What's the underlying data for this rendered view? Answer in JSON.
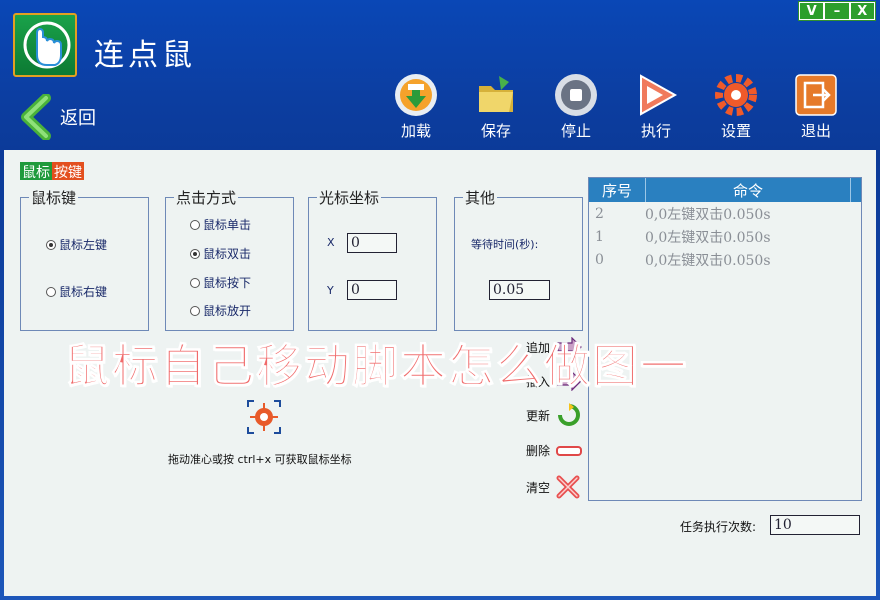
{
  "window": {
    "title": "连点鼠",
    "controls": [
      "V",
      "–",
      "X"
    ]
  },
  "nav": {
    "back_label": "返回"
  },
  "toolbar": [
    {
      "label": "加载",
      "icon": "load-icon"
    },
    {
      "label": "保存",
      "icon": "save-folder-icon"
    },
    {
      "label": "停止",
      "icon": "stop-icon"
    },
    {
      "label": "执行",
      "icon": "play-icon"
    },
    {
      "label": "设置",
      "icon": "gear-icon"
    },
    {
      "label": "退出",
      "icon": "exit-icon"
    }
  ],
  "tabs": {
    "mouse": "鼠标",
    "keyboard": "按键"
  },
  "mouse_key": {
    "title": "鼠标键",
    "left": "鼠标左键",
    "right": "鼠标右键"
  },
  "click_mode": {
    "title": "点击方式",
    "single": "鼠标单击",
    "double": "鼠标双击",
    "press": "鼠标按下",
    "release": "鼠标放开"
  },
  "cursor": {
    "title": "光标坐标",
    "x_label": "X",
    "y_label": "Y",
    "x_value": "0",
    "y_value": "0"
  },
  "other": {
    "title": "其他",
    "wait_label": "等待时间(秒):",
    "wait_value": "0.05"
  },
  "list": {
    "headers": [
      "序号",
      "命令"
    ],
    "rows": [
      {
        "index": "2",
        "command": "0,0左键双击0.050s"
      },
      {
        "index": "1",
        "command": "0,0左键双击0.050s"
      },
      {
        "index": "0",
        "command": "0,0左键双击0.050s"
      }
    ]
  },
  "actions": {
    "append": "追加",
    "insert": "插入",
    "update": "更新",
    "delete": "删除",
    "clear": "清空"
  },
  "hint": "拖动准心或按 ctrl+x 可获取鼠标坐标",
  "task": {
    "label": "任务执行次数:",
    "value": "10"
  },
  "watermark": "鼠标自己移动脚本怎么做图一"
}
